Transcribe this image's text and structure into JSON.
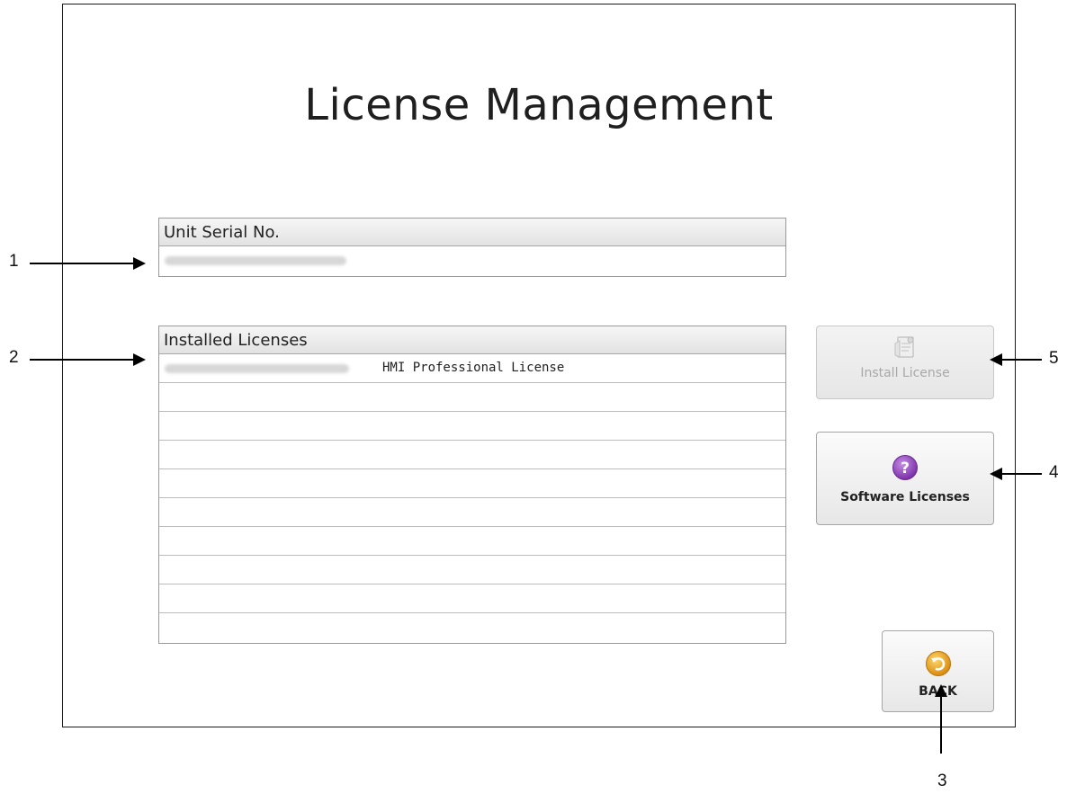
{
  "title": "License Management",
  "serial_panel": {
    "header": "Unit Serial No."
  },
  "licenses_panel": {
    "header": "Installed Licenses",
    "rows": [
      {
        "name": "HMI Professional License"
      },
      {
        "name": ""
      },
      {
        "name": ""
      },
      {
        "name": ""
      },
      {
        "name": ""
      },
      {
        "name": ""
      },
      {
        "name": ""
      },
      {
        "name": ""
      },
      {
        "name": ""
      },
      {
        "name": ""
      }
    ]
  },
  "buttons": {
    "install": {
      "label": "Install License",
      "icon": "install-license-icon",
      "enabled": false
    },
    "software": {
      "label": "Software Licenses",
      "icon": "help-icon",
      "icon_color": "#8e3fb5"
    },
    "back": {
      "label": "BACK",
      "icon": "back-icon",
      "icon_color": "#e6a21f"
    }
  },
  "callouts": {
    "c1": "1",
    "c2": "2",
    "c3": "3",
    "c4": "4",
    "c5": "5"
  }
}
